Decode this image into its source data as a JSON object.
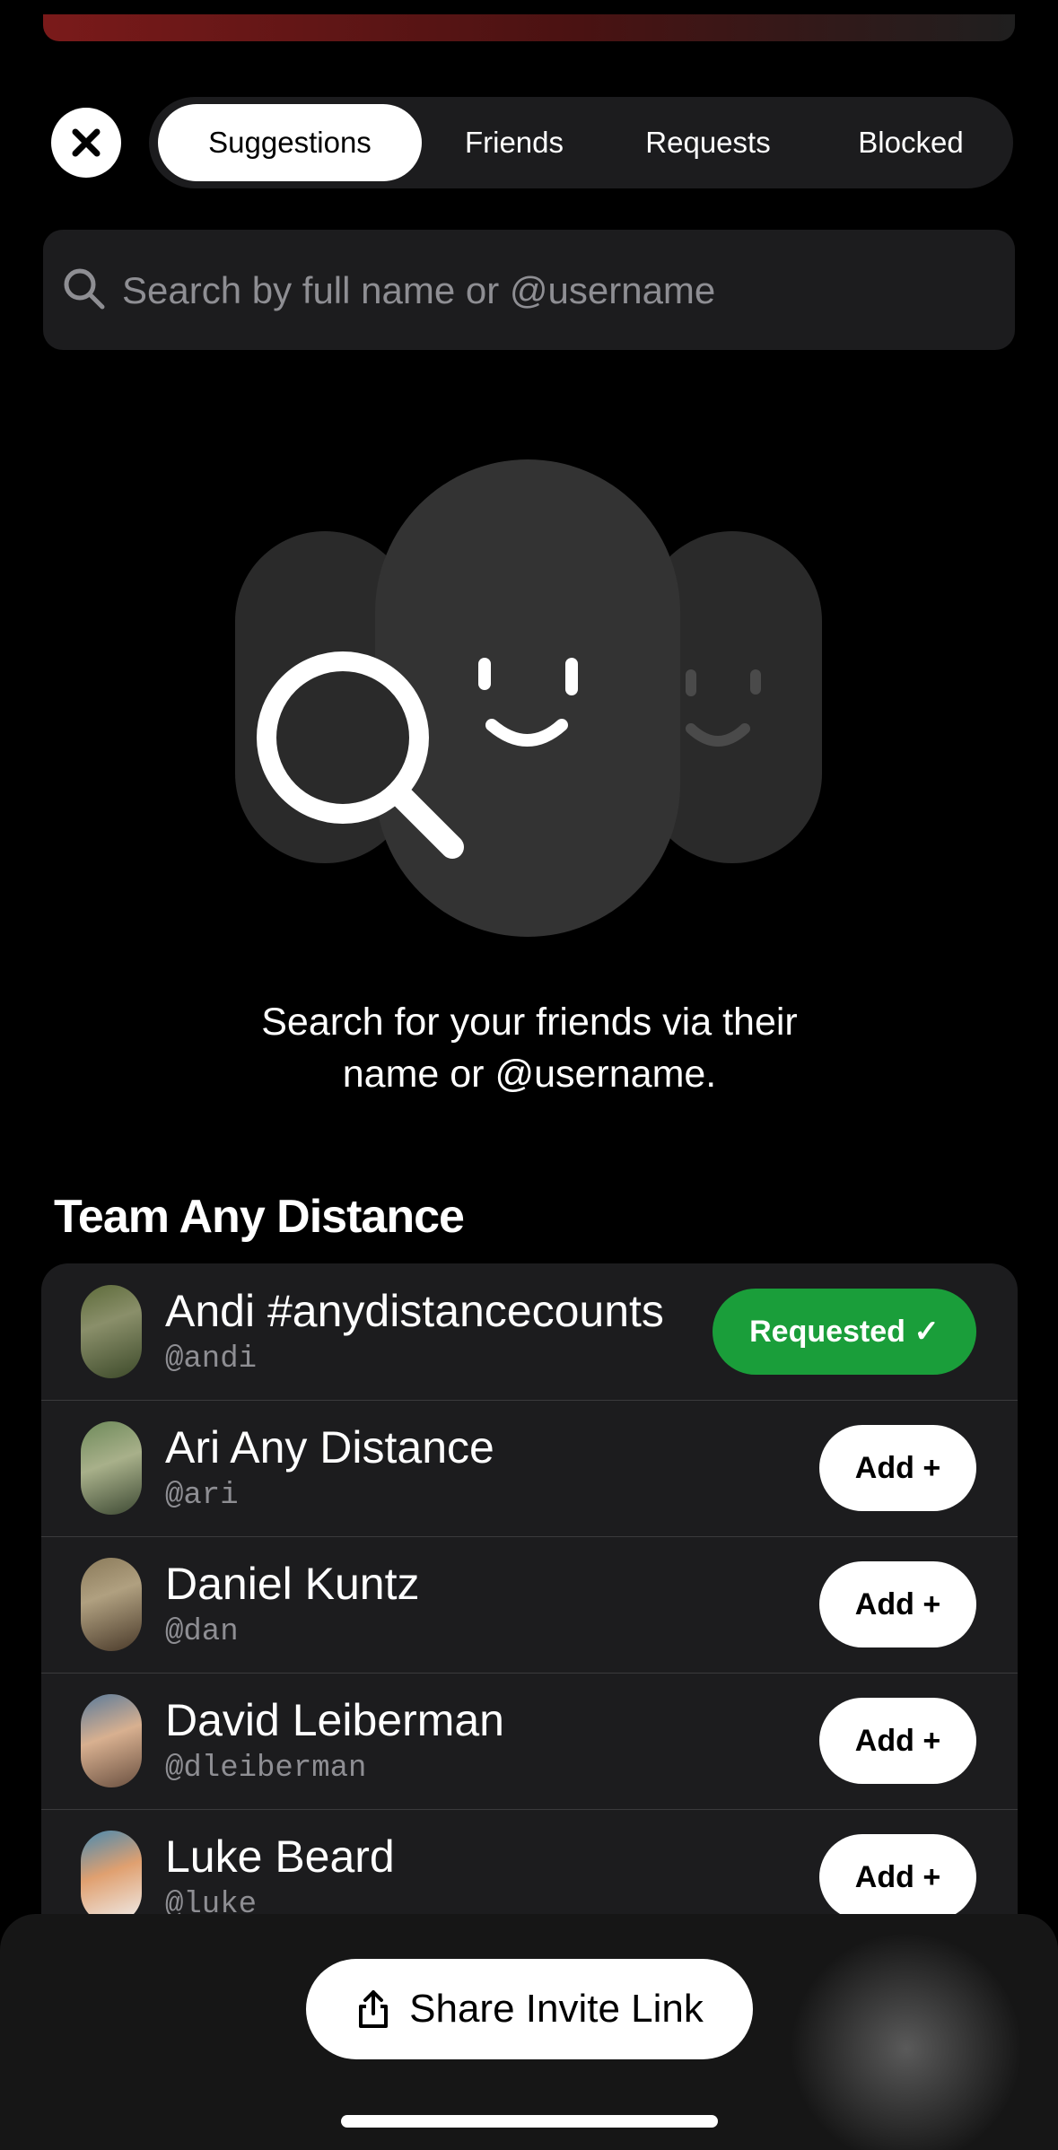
{
  "header": {
    "close_icon": "close-icon",
    "tabs": [
      {
        "label": "Suggestions",
        "active": true
      },
      {
        "label": "Friends",
        "active": false
      },
      {
        "label": "Requests",
        "active": false
      },
      {
        "label": "Blocked",
        "active": false
      }
    ]
  },
  "search": {
    "placeholder": "Search by full name or @username",
    "icon": "search-icon"
  },
  "empty_state": {
    "illustration": "faces-with-magnifier-illustration",
    "text": "Search for your friends via their\nname or @username."
  },
  "section": {
    "title": "Team Any Distance"
  },
  "users": [
    {
      "name": "Andi #anydistancecounts",
      "handle": "@andi",
      "button": "Requested ✓",
      "status": "requested"
    },
    {
      "name": "Ari Any Distance",
      "handle": "@ari",
      "button": "Add +",
      "status": "add"
    },
    {
      "name": "Daniel Kuntz",
      "handle": "@dan",
      "button": "Add +",
      "status": "add"
    },
    {
      "name": "David Leiberman",
      "handle": "@dleiberman",
      "button": "Add +",
      "status": "add"
    },
    {
      "name": "Luke Beard",
      "handle": "@luke",
      "button": "Add +",
      "status": "add"
    }
  ],
  "footer": {
    "share_label": "Share Invite Link",
    "share_icon": "share-icon"
  },
  "colors": {
    "background": "#000000",
    "surface": "#1c1c1e",
    "requested_green": "#1a9e3a",
    "secondary_text": "#8e8e93"
  }
}
